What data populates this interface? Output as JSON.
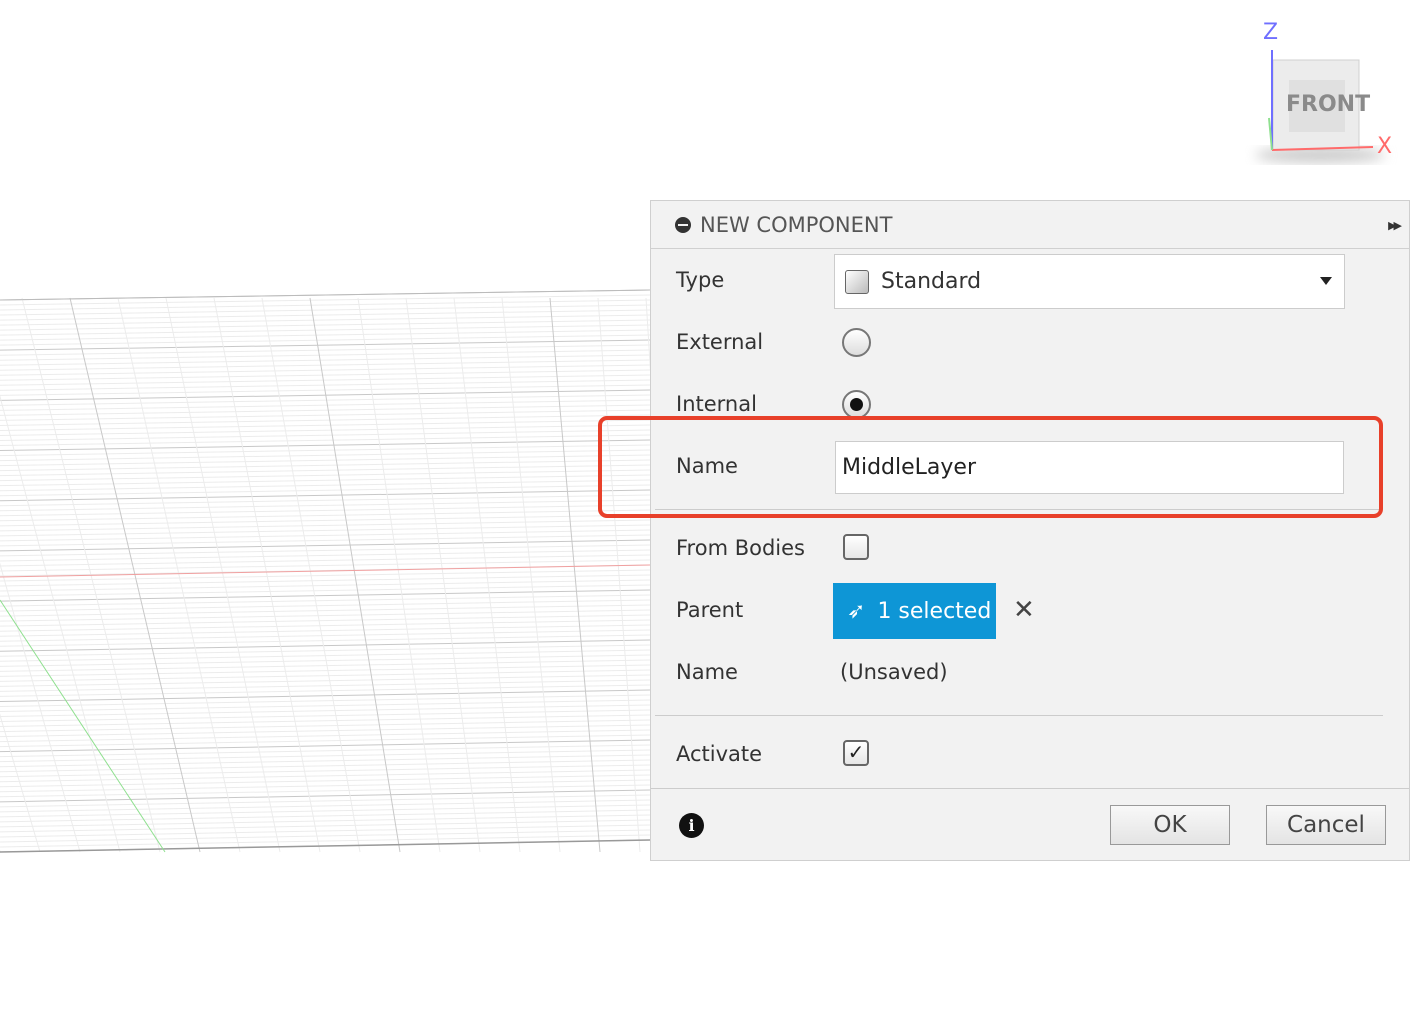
{
  "viewcube": {
    "face": "FRONT",
    "axis_z": "Z",
    "axis_x": "X"
  },
  "dialog": {
    "title": "NEW COMPONENT",
    "type_label": "Type",
    "type_value": "Standard",
    "external_label": "External",
    "external_selected": false,
    "internal_label": "Internal",
    "internal_selected": true,
    "name_label": "Name",
    "name_value": "MiddleLayer",
    "from_bodies_label": "From Bodies",
    "from_bodies_checked": false,
    "parent_label": "Parent",
    "parent_value": "1 selected",
    "doc_name_label": "Name",
    "doc_name_value": "(Unsaved)",
    "activate_label": "Activate",
    "activate_checked": true,
    "ok": "OK",
    "cancel": "Cancel"
  },
  "colors": {
    "accent": "#0e96d6",
    "highlight": "#e8402a"
  }
}
